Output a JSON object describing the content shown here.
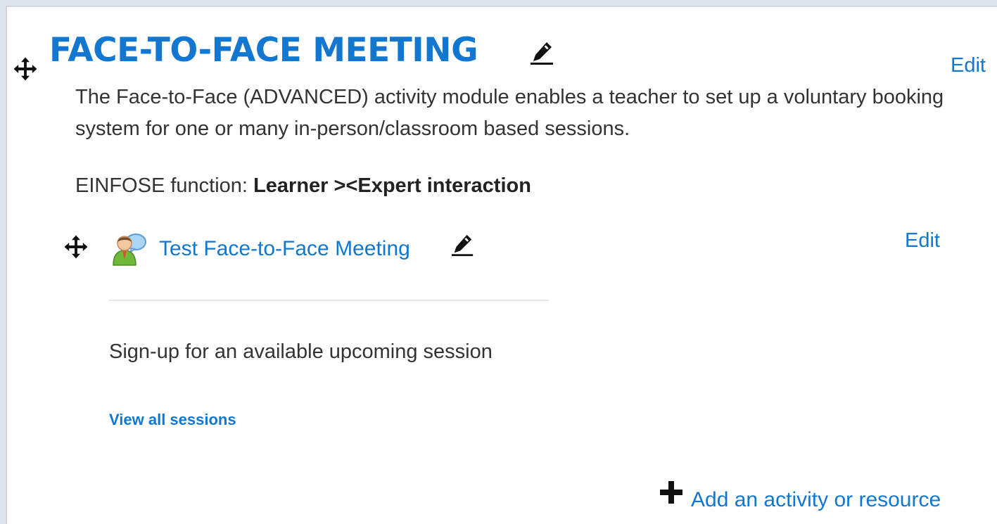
{
  "section": {
    "title": "FACE-TO-FACE MEETING",
    "edit_label": "Edit",
    "summary": "The Face-to-Face (ADVANCED) activity module enables a teacher to set up a voluntary booking system for one or many in-person/classroom based sessions.",
    "function_label": "EINFOSE function:",
    "function_value": "Learner ><Expert interaction"
  },
  "activity": {
    "name": "Test Face-to-Face Meeting",
    "edit_label": "Edit",
    "icon": "face-to-face-activity-icon",
    "intro": "Sign-up for an available upcoming session",
    "view_all_label": "View all sessions"
  },
  "footer": {
    "add_label": "Add an activity or resource"
  },
  "colors": {
    "link": "#1177d1",
    "text": "#333333",
    "background": "#ffffff"
  }
}
